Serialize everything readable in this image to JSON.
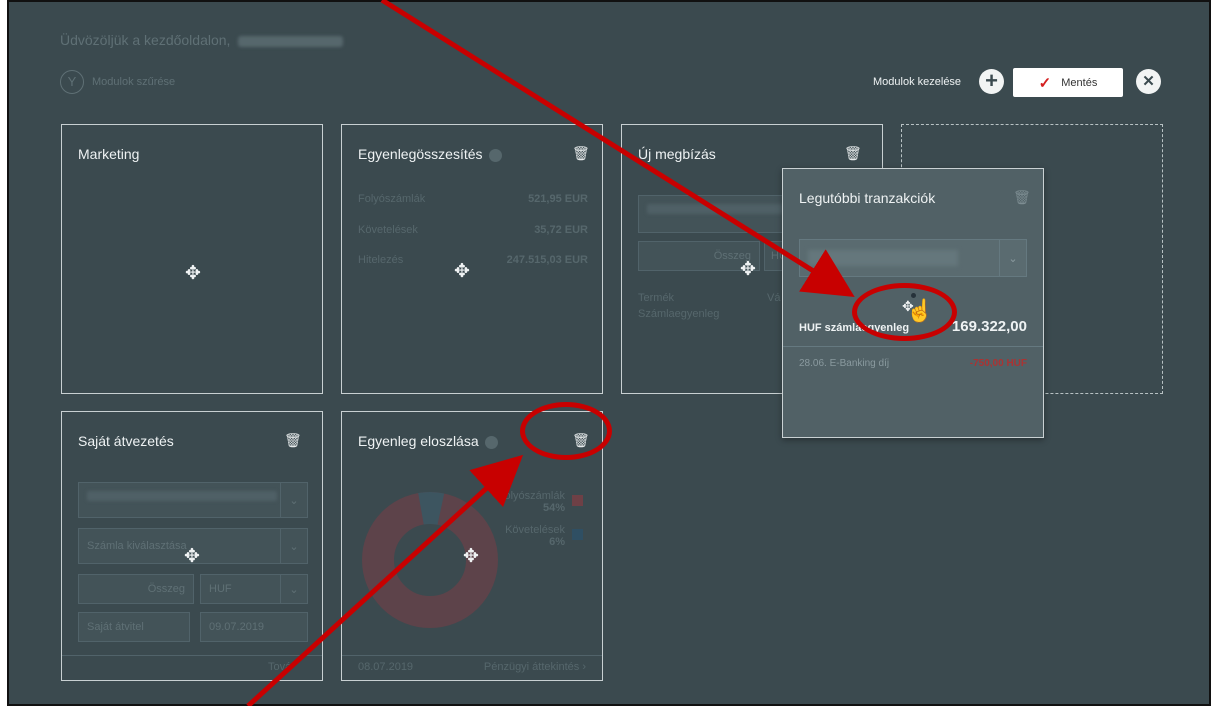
{
  "header": {
    "welcome": "Üdvözöljük a kezdőoldalon,",
    "filter_label": "Modulok szűrése",
    "manage_label": "Modulok kezelése",
    "save_label": "Mentés"
  },
  "cards": {
    "marketing": {
      "title": "Marketing"
    },
    "balance_summary": {
      "title": "Egyenlegösszesítés",
      "rows": [
        {
          "label": "Folyószámlák",
          "value": "521,95 EUR"
        },
        {
          "label": "Követelések",
          "value": "35,72 EUR"
        },
        {
          "label": "Hitelezés",
          "value": "247.515,03 EUR"
        }
      ]
    },
    "new_order": {
      "title": "Új megbízás",
      "amount_placeholder": "Összeg",
      "currency": "HU",
      "product_label": "Termék",
      "product_value": "Vá",
      "account_balance_label": "Számlaegyenleg"
    },
    "own_transfer": {
      "title": "Saját átvezetés",
      "account_select": "Számla kiválasztása",
      "amount_placeholder": "Összeg",
      "currency": "HUF",
      "reference": "Saját átvitel",
      "date": "09.07.2019",
      "more_link": "Tová"
    },
    "balance_distribution": {
      "title": "Egyenleg eloszlása",
      "date": "08.07.2019",
      "link": "Pénzügyi áttekintés",
      "legend": [
        {
          "label": "Folyószámlák",
          "percent": "54%",
          "color": "#6e3a40"
        },
        {
          "label": "Követelések",
          "percent": "6%",
          "color": "#2f5f7a"
        }
      ]
    },
    "recent_transactions": {
      "title": "Legutóbbi tranzakciók",
      "balance_label": "HUF számlaegyenleg",
      "balance_value": "169.322,00",
      "transactions": [
        {
          "date": "28.06.",
          "description": "E-Banking díj",
          "amount": "-750,00 HUF"
        }
      ]
    }
  },
  "colors": {
    "background": "#3b4a4f",
    "annotation_red": "#c80000",
    "save_check": "#d42020"
  }
}
